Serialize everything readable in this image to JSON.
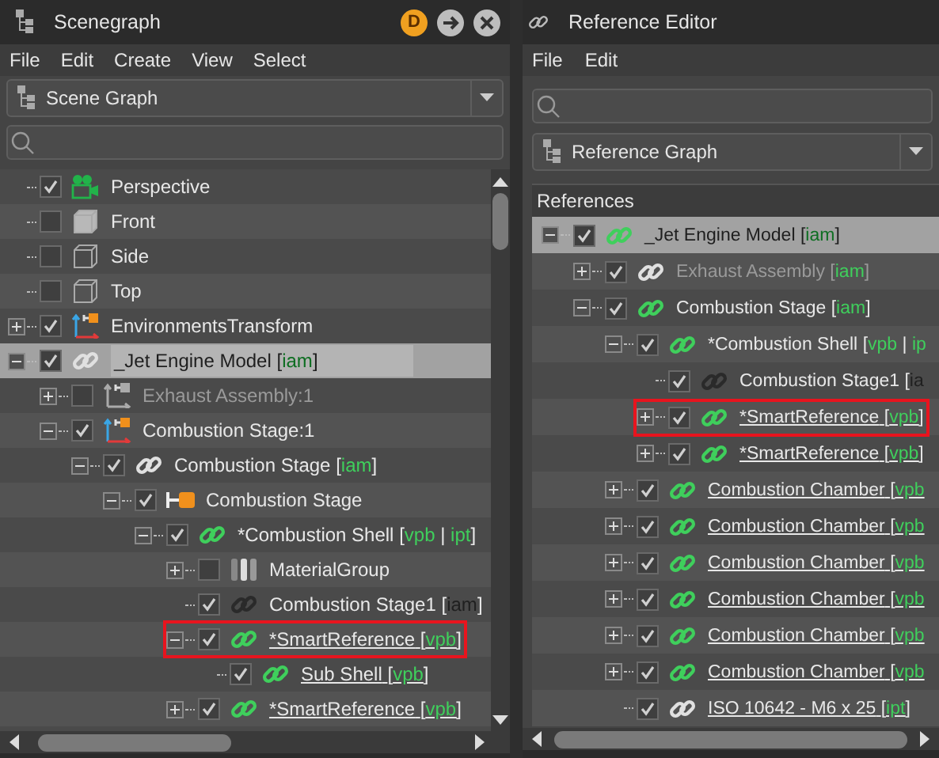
{
  "scenegraph": {
    "title": "Scenegraph",
    "badge": "D",
    "menu": [
      "File",
      "Edit",
      "Create",
      "View",
      "Select"
    ],
    "view_selector": "Scene Graph",
    "tree": [
      {
        "label": "Perspective",
        "kind": "camera",
        "checked": true,
        "selected": false,
        "outlined": false,
        "dimmed": false,
        "underlined": false
      },
      {
        "label": "Front",
        "kind": "cube-solid",
        "checked": false,
        "selected": false,
        "outlined": false,
        "dimmed": false,
        "underlined": false
      },
      {
        "label": "Side",
        "kind": "cube-wire",
        "checked": false,
        "selected": false,
        "outlined": false,
        "dimmed": false,
        "underlined": false
      },
      {
        "label": "Top",
        "kind": "cube-wire",
        "checked": false,
        "selected": false,
        "outlined": false,
        "dimmed": false,
        "underlined": false
      },
      {
        "label": "EnvironmentsTransform",
        "kind": "transform",
        "checked": true,
        "expanded": false,
        "selected": false,
        "outlined": false,
        "dimmed": false,
        "underlined": false
      },
      {
        "label": "_Jet Engine Model",
        "tag": "[iam]",
        "kind": "link-light",
        "checked": true,
        "expanded": true,
        "selected": true,
        "outlined": false,
        "dimmed": false,
        "underlined": false,
        "children": [
          {
            "label": "Exhaust Assembly:1",
            "kind": "transform-dim",
            "checked": false,
            "expanded": false,
            "selected": false,
            "outlined": false,
            "dimmed": true,
            "underlined": false
          },
          {
            "label": "Combustion Stage:1",
            "kind": "transform",
            "checked": true,
            "expanded": true,
            "selected": false,
            "outlined": false,
            "dimmed": false,
            "underlined": false,
            "children": [
              {
                "label": "Combustion Stage",
                "tag": "[iam]",
                "kind": "link-light",
                "checked": true,
                "expanded": true,
                "selected": false,
                "outlined": false,
                "dimmed": false,
                "underlined": false,
                "children": [
                  {
                    "label": "Combustion Stage",
                    "kind": "part",
                    "checked": true,
                    "expanded": true,
                    "selected": false,
                    "outlined": false,
                    "dimmed": false,
                    "underlined": false,
                    "children": [
                      {
                        "label": "*Combustion Shell",
                        "tag": "[vpb | ipt]",
                        "kind": "link",
                        "checked": true,
                        "expanded": true,
                        "selected": false,
                        "outlined": false,
                        "dimmed": false,
                        "underlined": false,
                        "children": [
                          {
                            "label": "MaterialGroup",
                            "kind": "material",
                            "checked": false,
                            "expanded": false,
                            "selected": false,
                            "outlined": false,
                            "dimmed": false,
                            "underlined": false
                          },
                          {
                            "label": "Combustion Stage1",
                            "tag": "[iam]",
                            "kind": "link-dark",
                            "checked": true,
                            "selected": false,
                            "outlined": false,
                            "dimmed": false,
                            "underlined": false
                          },
                          {
                            "label": "*SmartReference",
                            "tag": "[vpb]",
                            "kind": "link",
                            "checked": true,
                            "expanded": true,
                            "selected": false,
                            "outlined": true,
                            "dimmed": false,
                            "underlined": true,
                            "children": [
                              {
                                "label": "Sub Shell",
                                "tag": "[vpb]",
                                "kind": "link",
                                "checked": true,
                                "selected": false,
                                "outlined": false,
                                "dimmed": false,
                                "underlined": true
                              }
                            ]
                          },
                          {
                            "label": "*SmartReference",
                            "tag": "[vpb]",
                            "kind": "link",
                            "checked": true,
                            "expanded": false,
                            "selected": false,
                            "outlined": false,
                            "dimmed": false,
                            "underlined": true
                          }
                        ]
                      }
                    ]
                  }
                ]
              }
            ]
          }
        ]
      }
    ]
  },
  "reference_editor": {
    "title": "Reference Editor",
    "menu": [
      "File",
      "Edit"
    ],
    "view_selector": "Reference Graph",
    "column_header": "References",
    "tree": [
      {
        "label": "_Jet Engine Model",
        "tag": "[iam]",
        "kind": "link",
        "checked": true,
        "expanded": true,
        "selected": true,
        "outlined": false,
        "dimmed": false,
        "underlined": false,
        "children": [
          {
            "label": "Exhaust Assembly",
            "tag": "[iam]",
            "kind": "link-light",
            "checked": true,
            "expanded": false,
            "selected": false,
            "outlined": false,
            "dimmed": true,
            "underlined": false
          },
          {
            "label": "Combustion Stage",
            "tag": "[iam]",
            "kind": "link",
            "checked": true,
            "expanded": true,
            "selected": false,
            "outlined": false,
            "dimmed": false,
            "underlined": false,
            "children": [
              {
                "label": "*Combustion Shell",
                "tag": "[vpb | ip",
                "kind": "link",
                "checked": true,
                "expanded": true,
                "selected": false,
                "outlined": false,
                "dimmed": false,
                "underlined": false,
                "children": [
                  {
                    "label": "Combustion Stage1",
                    "tag": "[ia",
                    "kind": "link-dark",
                    "checked": true,
                    "selected": false,
                    "outlined": false,
                    "dimmed": false,
                    "underlined": false
                  },
                  {
                    "label": "*SmartReference",
                    "tag": "[vpb]",
                    "kind": "link",
                    "checked": true,
                    "expanded": false,
                    "selected": false,
                    "outlined": true,
                    "dimmed": false,
                    "underlined": true
                  },
                  {
                    "label": "*SmartReference",
                    "tag": "[vpb]",
                    "kind": "link",
                    "checked": true,
                    "expanded": false,
                    "selected": false,
                    "outlined": false,
                    "dimmed": false,
                    "underlined": true
                  }
                ]
              },
              {
                "label": "Combustion Chamber",
                "tag": "[vpb",
                "kind": "link",
                "checked": true,
                "expanded": false,
                "selected": false,
                "outlined": false,
                "dimmed": false,
                "underlined": true
              },
              {
                "label": "Combustion Chamber",
                "tag": "[vpb",
                "kind": "link",
                "checked": true,
                "expanded": false,
                "selected": false,
                "outlined": false,
                "dimmed": false,
                "underlined": true
              },
              {
                "label": "Combustion Chamber",
                "tag": "[vpb",
                "kind": "link",
                "checked": true,
                "expanded": false,
                "selected": false,
                "outlined": false,
                "dimmed": false,
                "underlined": true
              },
              {
                "label": "Combustion Chamber",
                "tag": "[vpb",
                "kind": "link",
                "checked": true,
                "expanded": false,
                "selected": false,
                "outlined": false,
                "dimmed": false,
                "underlined": true
              },
              {
                "label": "Combustion Chamber",
                "tag": "[vpb",
                "kind": "link",
                "checked": true,
                "expanded": false,
                "selected": false,
                "outlined": false,
                "dimmed": false,
                "underlined": true
              },
              {
                "label": "Combustion Chamber",
                "tag": "[vpb",
                "kind": "link",
                "checked": true,
                "expanded": false,
                "selected": false,
                "outlined": false,
                "dimmed": false,
                "underlined": true
              },
              {
                "label": "ISO 10642 - M6 x 25",
                "tag": "[ipt]",
                "kind": "link-light",
                "checked": true,
                "selected": false,
                "outlined": false,
                "dimmed": false,
                "underlined": true
              }
            ]
          }
        ]
      }
    ]
  }
}
